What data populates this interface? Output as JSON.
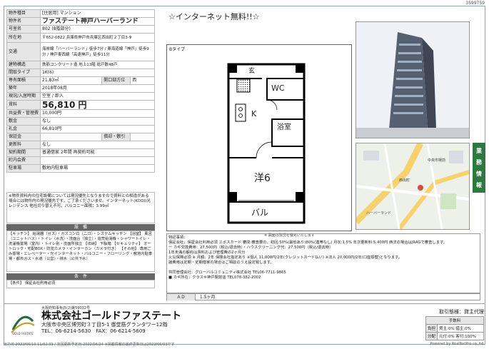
{
  "doc_no": "3599759",
  "left": {
    "rows": [
      {
        "k": "物件種目",
        "v": "[住居用] マンション"
      },
      {
        "k": "物件名",
        "v": "ファステート神戸ハーバーランド"
      },
      {
        "k": "号室名",
        "v": "802 (8階部分)"
      },
      {
        "k": "所在地",
        "v": "〒652-0822 兵庫県神戸市兵庫区西出町２丁目3-9"
      },
      {
        "k": "交通",
        "v": "海岸線「ハーバーランド」徒歩7分 / 東海道線「神戸」徒歩9分 / 神戸東西線「高速神戸」徒歩11分"
      },
      {
        "k": "建物構造",
        "v": "鉄筋コンクリート造 地上13階 総戸数48戸"
      },
      {
        "k": "間取タイプ",
        "v": "1K(6)"
      },
      {
        "k": "専有面積",
        "v": "21.83㎡",
        "k2": "開口部方位",
        "v2": "西"
      },
      {
        "k": "築年",
        "v": "2018年08月"
      },
      {
        "k": "現況/入居時期",
        "v": "空室 / 即入"
      },
      {
        "k": "賃料",
        "v": "56,810 円"
      },
      {
        "k": "共益費・管理費",
        "v": "10,000円"
      },
      {
        "k": "敷金",
        "v": "なし"
      },
      {
        "k": "礼金",
        "v": "66,810円"
      },
      {
        "k": "保証金",
        "v": "",
        "k2": "償却・敷引",
        "v2": ""
      },
      {
        "k": "更新料",
        "v": "なし"
      },
      {
        "k": "契約期間",
        "v": "普通借家 2年間 再契約可能"
      },
      {
        "k": "町内会費",
        "v": ""
      },
      {
        "k": "駐車場",
        "v": "敷地内駐車場"
      }
    ],
    "notes": "※物件資料内の住宅設備については現況優先となりますので資料との相違がある場合には物件内の現況優先です。ご了承くださいませ。インターネット(KDDI)光レジデンス 他社切り替え不可。バルコニー面積：3.99㎡",
    "equipment_title": "設　備",
    "equipment": "【キッチン】 給湯器（ガス）・ガスコンロ（二口）・システムキッチン 【浴室】 風呂（ユニットバス）・トイレ（水洗）・洗面台（独立）・追焚給湯機・シャワートイレ・洗濯機置場（室内）・トイレ別・洗面所独立 【収納】 下駄箱 【セキュリティ】 オートロック・宅配BOX・防犯カメラ・インターホン（カメラ付き） 【その他】 専用ごみ置場・エレベーター・光インターネット・バルコニー・フローリング・敷地内駐車場・都市ガス・水道（公営）・排水（公共下水）",
    "conditions_title": "条　件",
    "conditions": "【条件】 保証会社利用必須"
  },
  "headline": "☆インターネット無料!!☆",
  "plan": {
    "type_label": "Bタイプ",
    "rooms": {
      "genkan": "玄",
      "wc": "WC",
      "k": "K",
      "bath": "浴室",
      "western": "洋6",
      "balcony": "バル"
    },
    "caption": "※ 図面は現況を優先いたします"
  },
  "remarks": [
    "特記事項：",
    "保証会社：保証会社利用必須 エポスカード 審問:審査要の、初回:50%(最低あり)80%(連帯なし) 月次:1.5% 年次更新料:5,400円 西洋の場合はJRAGで審査します。",
    "一 カギ交換費用：27,500円（税込/退去時）・ハウスクリーニング代：27,500円（税込/退去時）",
    "1年未満の解約は賃料および管理費の2ヶ月分",
    "火災保険必須 ※ 月額：2年 保険会社指定あり ※個人 11,000円/2年(クレジットカード払い) ※法人 20,000円/2年(口座振替)となります。",
    "諸費用は定期・定期借家の場合はご相談のうえ設定致します。",
    "",
    "共同管理会社：グローバルコミュニティ株式会社 TEL06-7711-9865",
    "■ カギ所在：クラスキ神戸駅前店 TEL078-382-2002"
  ],
  "ad": {
    "label": "ＡＤ",
    "value": "1.5ヶ月"
  },
  "side_tab": "業務情報",
  "map": {
    "pins": [
      "西出町",
      "ハーバーランド",
      "中央市場前"
    ]
  },
  "company": {
    "license": "大阪府知事免許(2)第59032号",
    "name": "株式会社ゴールドファステート",
    "address": "大阪市中央区博労町３丁目5-1 御堂筋グランタワー12階",
    "tel": "TEL：06-6214-5630",
    "fax": "FAX：06-6214-5609",
    "logo_text": "GOLD FASTATE"
  },
  "deal": {
    "title": "取引態様：貸主代理",
    "header": "手数料",
    "rows": [
      {
        "k": "負担",
        "v": "貸主:0% 借主:0%"
      },
      {
        "k": "分配",
        "v": "元付:0% 客付:100%"
      }
    ]
  },
  "footer_left": "出力日:2022/06/10 11:02:39 / 次回更新予定日:2022/06/24 ※掲載情報の最終更新日は2022/06/03です",
  "powered": "Powered by RealNetPro co.,ltd."
}
